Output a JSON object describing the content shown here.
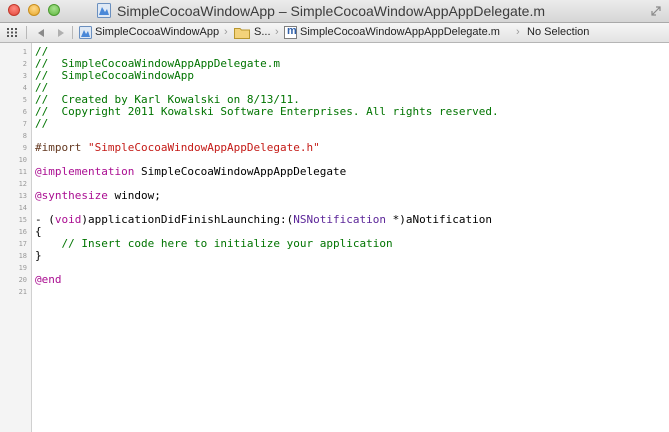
{
  "window": {
    "title": "SimpleCocoaWindowApp – SimpleCocoaWindowAppAppDelegate.m",
    "colors": {
      "close": "#ff5f57",
      "minimize": "#ffbd2e",
      "zoom": "#28c940"
    }
  },
  "jump_bar": {
    "crumbs": [
      {
        "label": "SimpleCocoaWindowApp",
        "icon": "project-icon"
      },
      {
        "label": "S...",
        "icon": "folder-icon"
      },
      {
        "label": "SimpleCocoaWindowAppAppDelegate.m",
        "icon": "objc-file-icon"
      },
      {
        "label": "No Selection"
      }
    ],
    "chevron": "›",
    "file_icon_glyph": "m"
  },
  "editor": {
    "line_numbers": [
      "1",
      "2",
      "3",
      "4",
      "5",
      "6",
      "7",
      "8",
      "9",
      "10",
      "11",
      "12",
      "13",
      "14",
      "15",
      "16",
      "17",
      "18",
      "19",
      "20",
      "21"
    ],
    "lines": [
      {
        "n": "1",
        "text": "//",
        "kind": "comment"
      },
      {
        "n": "2",
        "text": "//  SimpleCocoaWindowAppAppDelegate.m",
        "kind": "comment"
      },
      {
        "n": "3",
        "text": "//  SimpleCocoaWindowApp",
        "kind": "comment"
      },
      {
        "n": "4",
        "text": "//",
        "kind": "comment"
      },
      {
        "n": "5",
        "text": "//  Created by Karl Kowalski on 8/13/11.",
        "kind": "comment"
      },
      {
        "n": "6",
        "text": "//  Copyright 2011 Kowalski Software Enterprises. All rights reserved.",
        "kind": "comment"
      },
      {
        "n": "7",
        "text": "//",
        "kind": "comment"
      },
      {
        "n": "9",
        "directive": "#import ",
        "string": "\"SimpleCocoaWindowAppAppDelegate.h\""
      },
      {
        "n": "11",
        "keyword": "@implementation",
        "rest": " SimpleCocoaWindowAppAppDelegate"
      },
      {
        "n": "13",
        "keyword": "@synthesize",
        "rest": " window;"
      },
      {
        "n": "15",
        "pre": "- (",
        "type1": "void",
        "mid": ")applicationDidFinishLaunching:(",
        "type2": "NSNotification",
        "post": " *)aNotification"
      },
      {
        "n": "16",
        "text": "{",
        "kind": "plain"
      },
      {
        "n": "17",
        "text": "    // Insert code here to initialize your application",
        "kind": "comment"
      },
      {
        "n": "18",
        "text": "}",
        "kind": "plain"
      },
      {
        "n": "20",
        "keyword": "@end"
      }
    ]
  }
}
